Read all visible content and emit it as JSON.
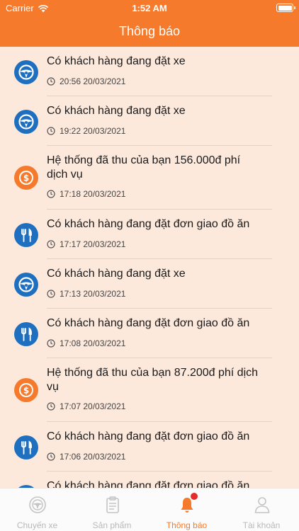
{
  "status_bar": {
    "carrier": "Carrier",
    "time": "1:52 AM"
  },
  "header": {
    "title": "Thông báo"
  },
  "colors": {
    "accent": "#f57a2c",
    "icon_blue": "#1e6fbf",
    "icon_orange": "#f57a2c",
    "background": "#fde9dc"
  },
  "notifications": [
    {
      "type": "car",
      "icon": "steering-wheel-icon",
      "text": "Có khách hàng đang đặt xe",
      "time": "20:56 20/03/2021"
    },
    {
      "type": "car",
      "icon": "steering-wheel-icon",
      "text": "Có khách hàng đang đặt xe",
      "time": "19:22 20/03/2021"
    },
    {
      "type": "fee",
      "icon": "dollar-coin-icon",
      "text": "Hệ thống đã thu của bạn 156.000đ phí dịch vụ",
      "time": "17:18 20/03/2021"
    },
    {
      "type": "food",
      "icon": "fork-knife-icon",
      "text": "Có khách hàng đang đặt đơn giao đồ ăn",
      "time": "17:17 20/03/2021"
    },
    {
      "type": "car",
      "icon": "steering-wheel-icon",
      "text": "Có khách hàng đang đặt xe",
      "time": "17:13 20/03/2021"
    },
    {
      "type": "food",
      "icon": "fork-knife-icon",
      "text": "Có khách hàng đang đặt đơn giao đồ ăn",
      "time": "17:08 20/03/2021"
    },
    {
      "type": "fee",
      "icon": "dollar-coin-icon",
      "text": "Hệ thống đã thu của bạn 87.200đ phí dịch vụ",
      "time": "17:07 20/03/2021"
    },
    {
      "type": "food",
      "icon": "fork-knife-icon",
      "text": "Có khách hàng đang đặt đơn giao đồ ăn",
      "time": "17:06 20/03/2021"
    },
    {
      "type": "food",
      "icon": "fork-knife-icon",
      "text": "Có khách hàng đang đặt đơn giao đồ ăn",
      "time": ""
    }
  ],
  "tabs": [
    {
      "label": "Chuyến xe",
      "icon": "steering-wheel-icon",
      "active": false
    },
    {
      "label": "Sản phẩm",
      "icon": "clipboard-icon",
      "active": false
    },
    {
      "label": "Thông báo",
      "icon": "bell-icon",
      "active": true
    },
    {
      "label": "Tài khoản",
      "icon": "user-icon",
      "active": false
    }
  ]
}
